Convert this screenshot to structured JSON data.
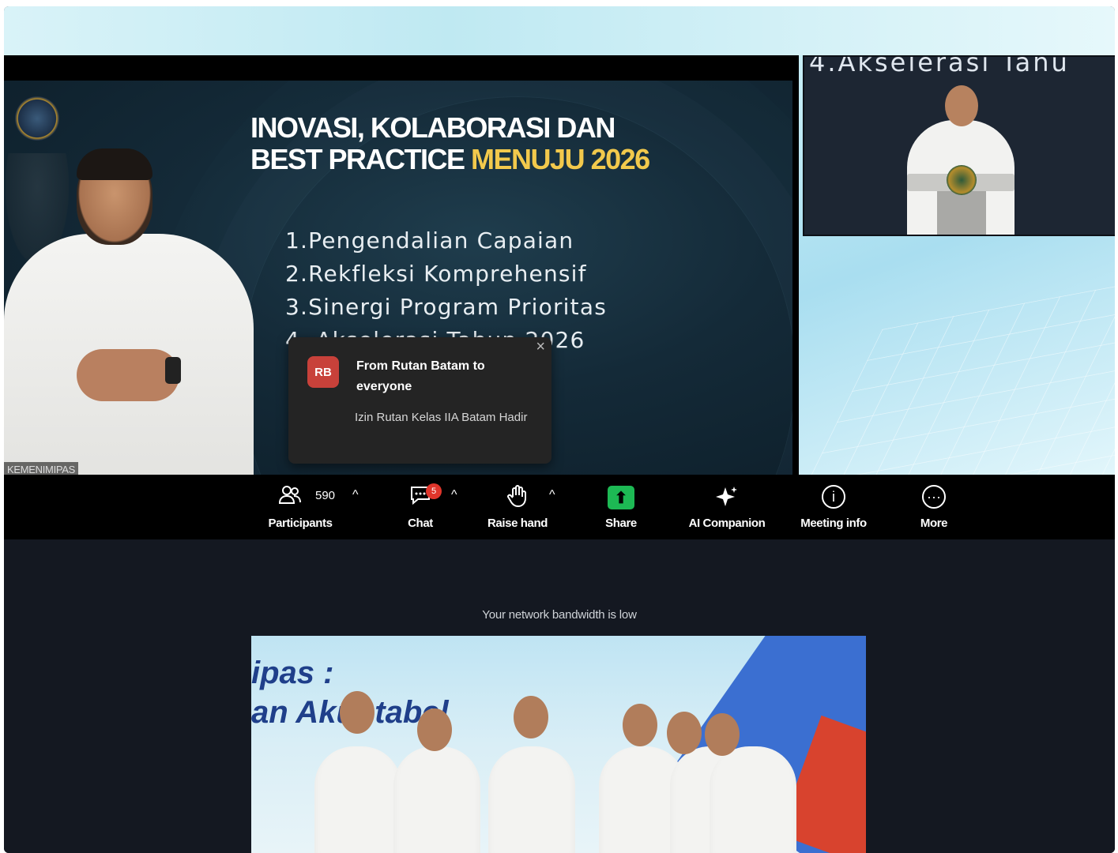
{
  "slide": {
    "title_line1": "INOVASI, KOLABORASI DAN",
    "title_line2_white": "BEST PRACTICE",
    "title_line2_highlight": "MENUJU 2026",
    "items": [
      "1.Pengendalian Capaian",
      "2.Rekfleksi Komprehensif",
      "3.Sinergi Program Prioritas",
      "4. Akselerasi Tahun 2026"
    ]
  },
  "speaker_name_tag": "KEMENIMIPAS",
  "thumbnail": {
    "banner_text": "4.Akselerasi Tahu"
  },
  "chat_toast": {
    "avatar_initials": "RB",
    "from": "From Rutan Batam to everyone",
    "message": "Izin Rutan Kelas IIA Batam Hadir",
    "close_glyph": "×"
  },
  "toolbar": {
    "participants": {
      "label": "Participants",
      "count": "590",
      "icon": "participants-icon"
    },
    "chat": {
      "label": "Chat",
      "badge": "5",
      "icon": "chat-icon"
    },
    "raise_hand": {
      "label": "Raise hand",
      "icon": "hand-icon"
    },
    "share": {
      "label": "Share",
      "icon": "share-icon"
    },
    "ai_companion": {
      "label": "AI Companion",
      "icon": "sparkle-icon"
    },
    "meeting_info": {
      "label": "Meeting info",
      "icon": "info-icon"
    },
    "more": {
      "label": "More",
      "icon": "more-icon"
    },
    "caret": "^"
  },
  "bandwidth_notice": "Your network bandwidth is low",
  "second_video": {
    "text_line1": "ipas :",
    "text_line2": "an Akuntabel"
  },
  "colors": {
    "highlight": "#f2c94c",
    "share_green": "#1db954",
    "badge_red": "#e0352b",
    "avatar_red": "#c8413a"
  }
}
